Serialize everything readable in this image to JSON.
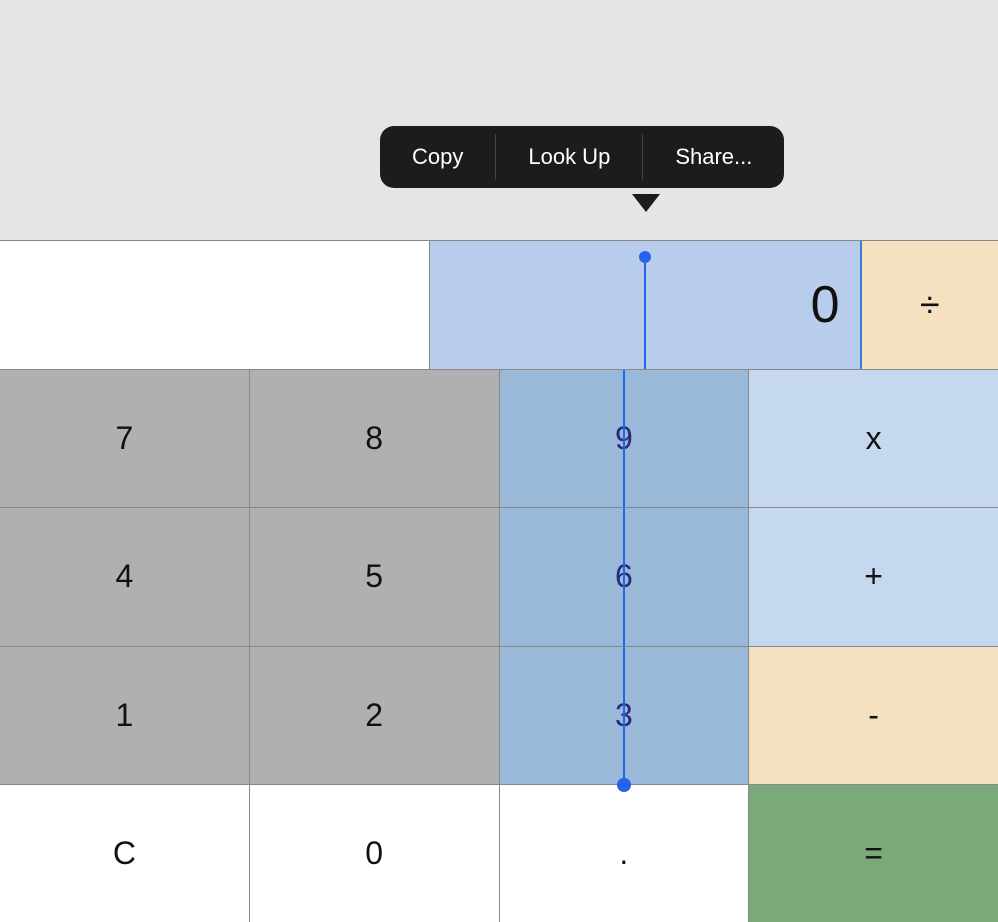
{
  "contextMenu": {
    "items": [
      "Copy",
      "Look Up",
      "Share..."
    ]
  },
  "display": {
    "value": "0",
    "selectedText": "0"
  },
  "buttons": {
    "row1": [
      {
        "label": "7",
        "type": "gray"
      },
      {
        "label": "8",
        "type": "gray"
      },
      {
        "label": "9",
        "type": "selected"
      },
      {
        "label": "x",
        "type": "op-blue"
      }
    ],
    "row2": [
      {
        "label": "4",
        "type": "gray"
      },
      {
        "label": "5",
        "type": "gray"
      },
      {
        "label": "6",
        "type": "selected"
      },
      {
        "label": "+",
        "type": "op-blue"
      }
    ],
    "row3": [
      {
        "label": "1",
        "type": "gray"
      },
      {
        "label": "2",
        "type": "gray"
      },
      {
        "label": "3",
        "type": "selected"
      },
      {
        "label": "-",
        "type": "op-orange"
      }
    ],
    "row4": [
      {
        "label": "C",
        "type": "white"
      },
      {
        "label": "0",
        "type": "white"
      },
      {
        "label": ".",
        "type": "white"
      },
      {
        "label": "=",
        "type": "green"
      }
    ]
  },
  "divButton": {
    "label": "÷"
  }
}
